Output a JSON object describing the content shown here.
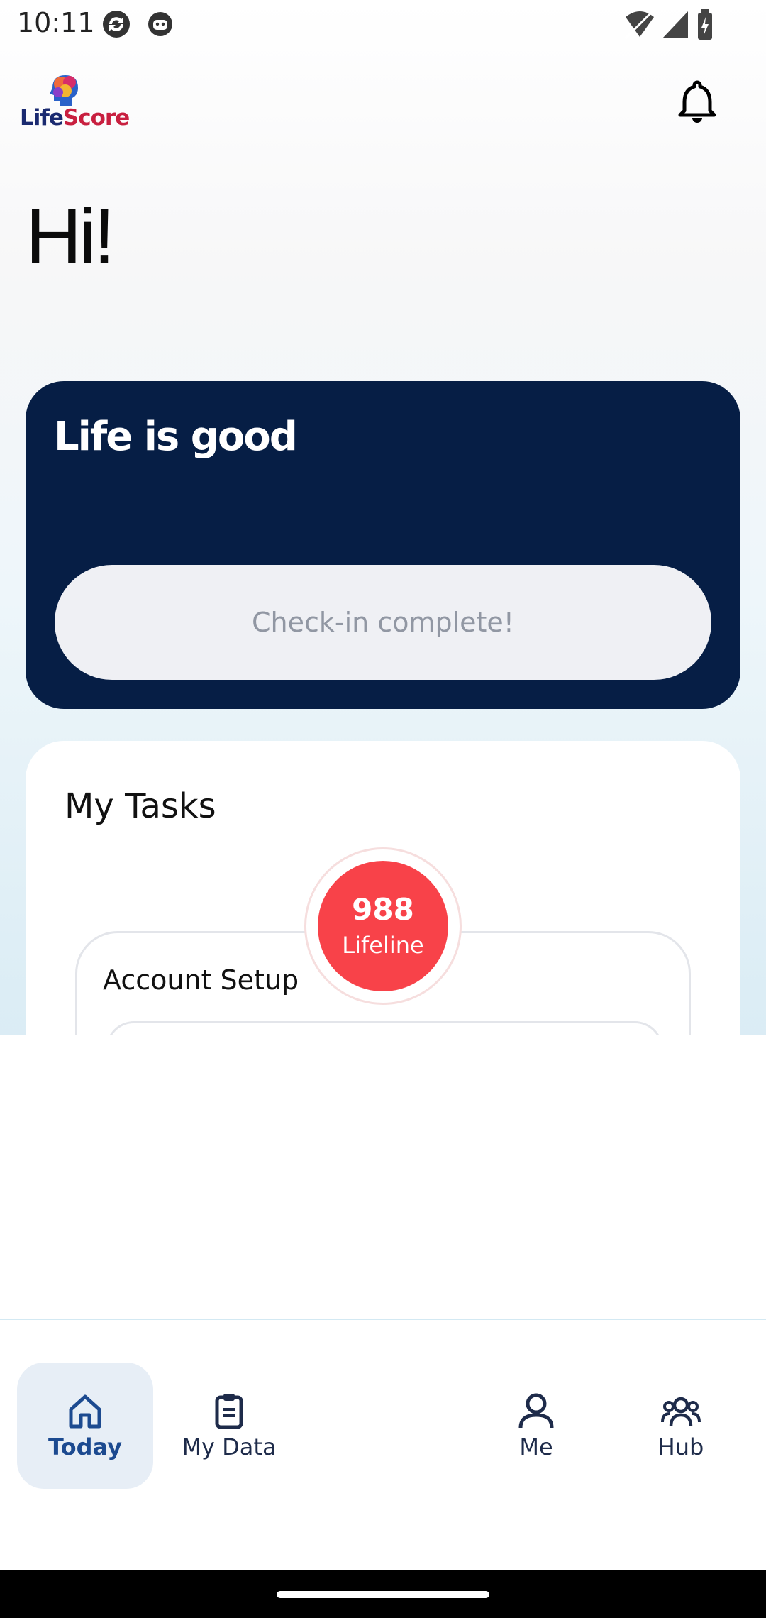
{
  "status_bar": {
    "time": "10:11"
  },
  "header": {
    "logo_text_life": "Life",
    "logo_text_score": "Score"
  },
  "greeting": "Hi!",
  "mood_card": {
    "title": "Life is good",
    "checkin_label": "Check-in complete!"
  },
  "tasks": {
    "title": "My Tasks",
    "lifeline_value": "988",
    "lifeline_label": "Lifeline",
    "account_setup_title": "Account Setup"
  },
  "bottom_nav": {
    "items": [
      {
        "label": "Today",
        "icon": "home-icon",
        "active": true
      },
      {
        "label": "My Data",
        "icon": "clipboard-icon",
        "active": false
      },
      {
        "label": "Me",
        "icon": "person-icon",
        "active": false
      },
      {
        "label": "Hub",
        "icon": "group-icon",
        "active": false
      }
    ]
  },
  "colors": {
    "card_navy": "#061e45",
    "lifeline_red": "#f84249",
    "nav_active_bg": "#e7eef6",
    "nav_active_text": "#1c4a90"
  }
}
